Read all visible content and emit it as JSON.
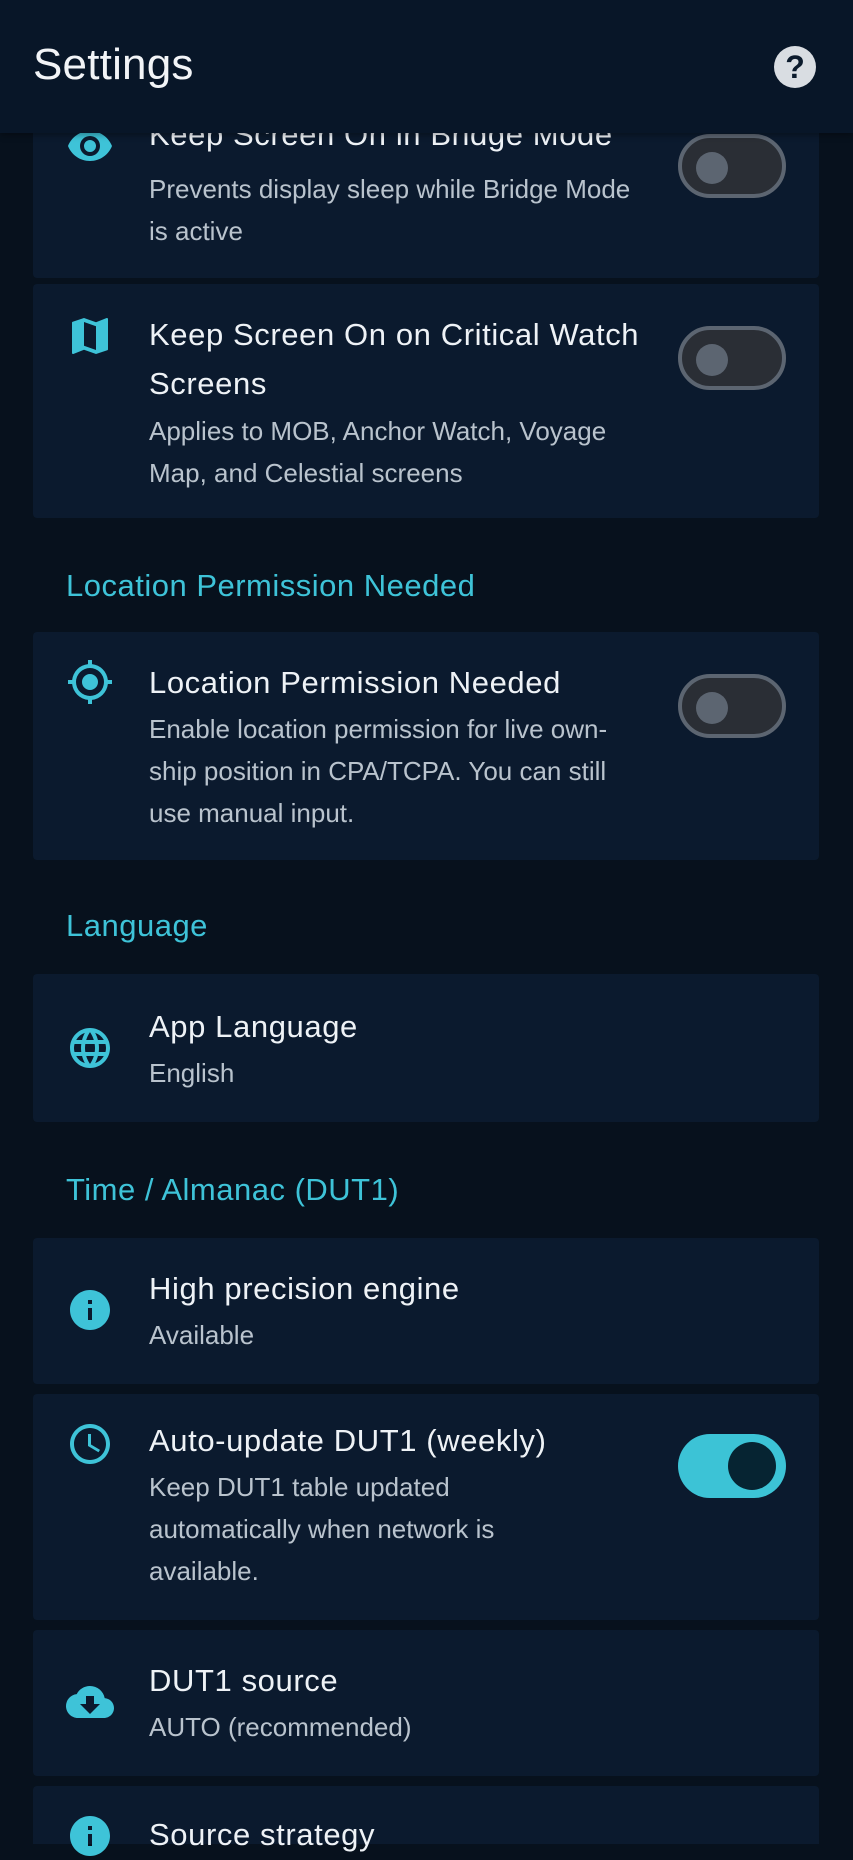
{
  "appbar": {
    "title": "Settings",
    "help_glyph": "?"
  },
  "colors": {
    "accent": "#3ec3d8",
    "card": "#0b1a2e",
    "background": "#07111d",
    "appbar": "#081628"
  },
  "items": [
    {
      "icon": "eye-icon",
      "title": "Keep Screen On in Bridge Mode",
      "subtitle": "Prevents display sleep while Bridge Mode is active",
      "toggle": false
    },
    {
      "icon": "map-icon",
      "title": "Keep Screen On on Critical Watch Screens",
      "subtitle": "Applies to MOB, Anchor Watch, Voyage Map, and Celestial screens",
      "toggle": false
    },
    {
      "icon": "crosshair-icon",
      "title": "Location Permission Needed",
      "subtitle": "Enable location permission for live own-ship position in CPA/TCPA. You can still use manual input.",
      "toggle": false
    },
    {
      "icon": "globe-icon",
      "title": "App Language",
      "subtitle": "English"
    },
    {
      "icon": "info-icon",
      "title": "High precision engine",
      "subtitle": "Available"
    },
    {
      "icon": "clock-icon",
      "title": "Auto-update DUT1 (weekly)",
      "subtitle": "Keep DUT1 table updated automatically when network is available.",
      "toggle": true
    },
    {
      "icon": "cloud-download-icon",
      "title": "DUT1 source",
      "subtitle": "AUTO (recommended)"
    },
    {
      "icon": "info-icon",
      "title": "Source strategy"
    }
  ],
  "sections": {
    "location": "Location Permission Needed",
    "language": "Language",
    "time": "Time / Almanac (DUT1)"
  }
}
